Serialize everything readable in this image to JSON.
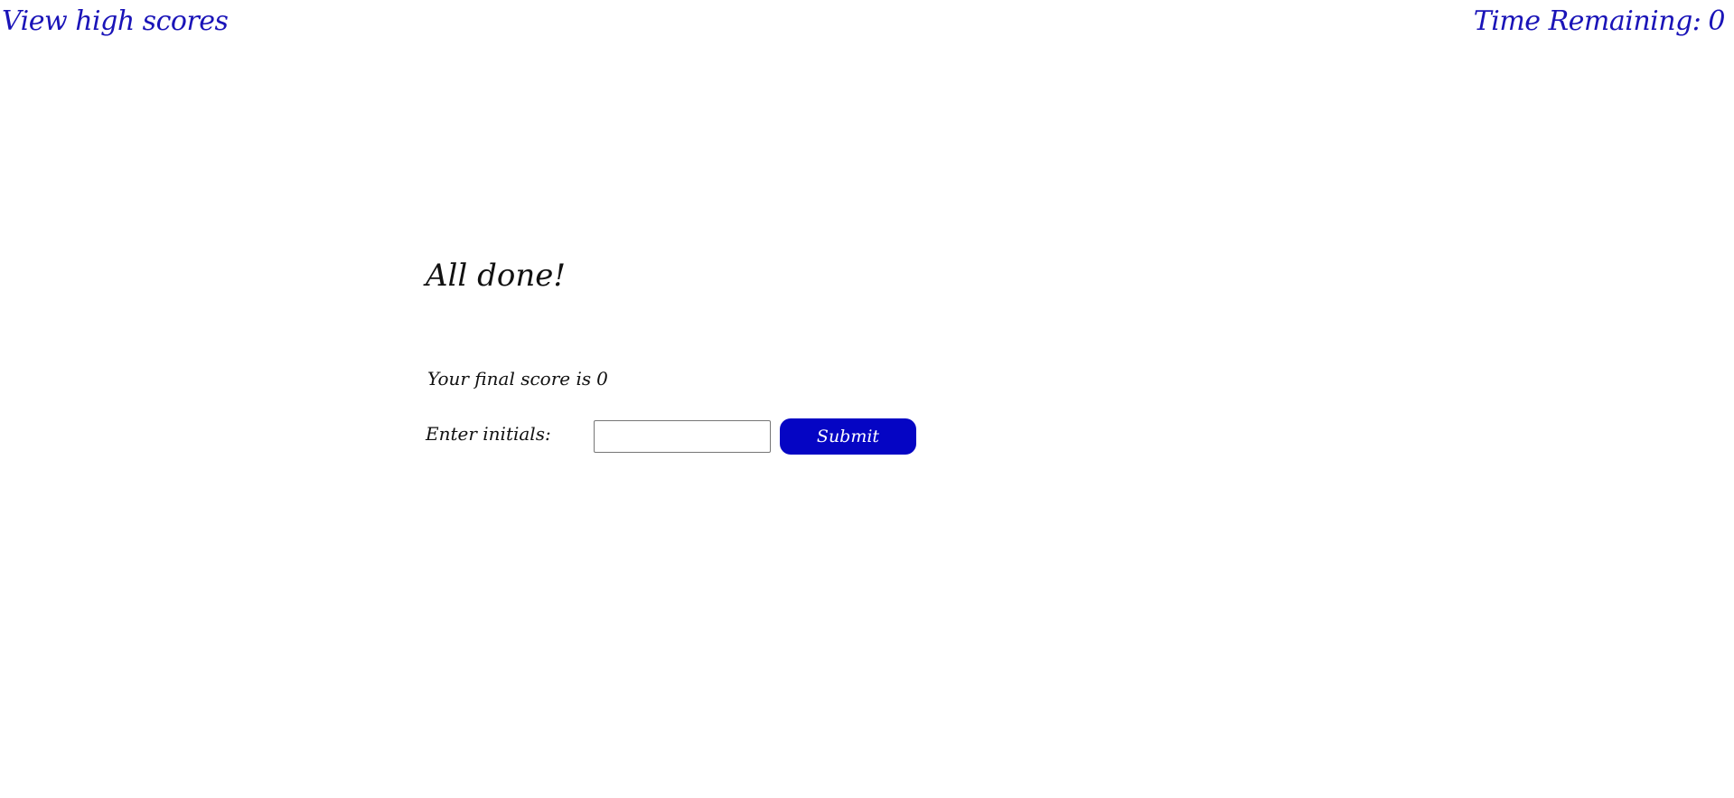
{
  "header": {
    "high_scores_link": "View high scores",
    "timer_label": "Time Remaining:",
    "timer_value": "0"
  },
  "main": {
    "title": "All done!",
    "final_score_label": "Your final score is",
    "final_score_value": "0",
    "initials_label": "Enter initials:",
    "initials_value": "",
    "submit_label": "Submit"
  },
  "colors": {
    "link_color": "#1a14b8",
    "button_bg": "#0505c4",
    "button_text": "#ffffff",
    "text": "#111111"
  }
}
